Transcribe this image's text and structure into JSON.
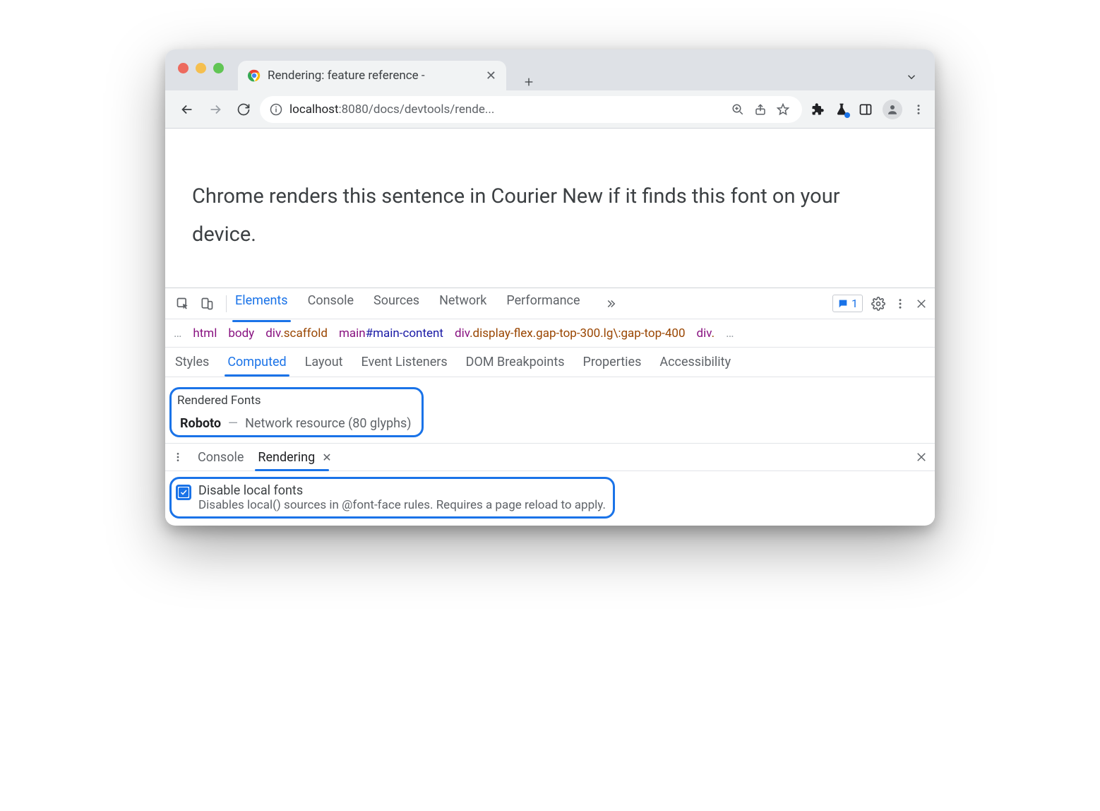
{
  "tab": {
    "title": "Rendering: feature reference -"
  },
  "url": {
    "scheme_host": "localhost",
    "port_path": ":8080/docs/devtools/rende..."
  },
  "page": {
    "sentence": "Chrome renders this sentence in Courier New if it finds this font on your device."
  },
  "devtools": {
    "tabs": [
      "Elements",
      "Console",
      "Sources",
      "Network",
      "Performance"
    ],
    "issues_count": "1",
    "breadcrumb": {
      "items": [
        {
          "tag": "html",
          "suffix": ""
        },
        {
          "tag": "body",
          "suffix": ""
        },
        {
          "tag": "div",
          "suffix": ".scaffold"
        },
        {
          "tag": "main",
          "suffix": "#main-content"
        },
        {
          "tag": "div",
          "suffix": ".display-flex.gap-top-300.lg\\:gap-top-400"
        },
        {
          "tag": "div",
          "suffix": "."
        }
      ]
    },
    "subtabs": [
      "Styles",
      "Computed",
      "Layout",
      "Event Listeners",
      "DOM Breakpoints",
      "Properties",
      "Accessibility"
    ],
    "rendered_fonts": {
      "header": "Rendered Fonts",
      "name": "Roboto",
      "source": "Network resource",
      "glyphs": "(80 glyphs)"
    },
    "drawer": {
      "tabs": [
        "Console",
        "Rendering"
      ],
      "option": {
        "title": "Disable local fonts",
        "desc": "Disables local() sources in @font-face rules. Requires a page reload to apply."
      }
    }
  }
}
